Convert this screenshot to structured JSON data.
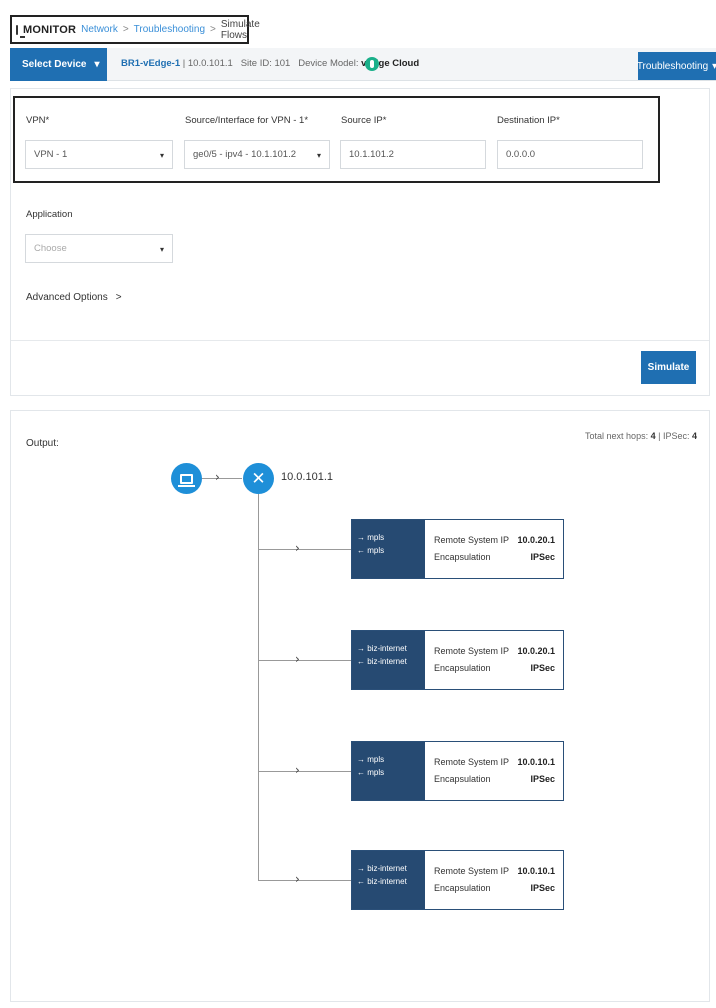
{
  "breadcrumb": {
    "monitor": "MONITOR",
    "network": "Network",
    "troubleshooting": "Troubleshooting",
    "current": "Simulate Flows",
    "separator": ">"
  },
  "device_bar": {
    "select_device": "Select Device",
    "select_caret": "▾",
    "device_name": "BR1-vEdge-1",
    "device_ip": " | 10.0.101.1",
    "site_id": "Site ID: 101",
    "model_label": "Device Model:",
    "model_value": "vEdge Cloud",
    "troubleshooting_btn": "Troubleshooting",
    "troubleshooting_caret": "▾"
  },
  "form": {
    "vpn_label": "VPN*",
    "vpn_value": "VPN - 1",
    "source_iface_label": "Source/Interface for VPN - 1*",
    "source_iface_value": "ge0/5 - ipv4 - 10.1.101.2",
    "source_ip_label": "Source IP*",
    "source_ip_value": "10.1.101.2",
    "dest_ip_label": "Destination IP*",
    "dest_ip_value": "0.0.0.0",
    "application_label": "Application",
    "application_placeholder": "Choose",
    "advanced_options": "Advanced Options",
    "advanced_chevron": ">",
    "caret": "▾",
    "simulate_btn": "Simulate"
  },
  "output": {
    "label": "Output:",
    "hops_label": "Total next hops:",
    "hops_value": "4",
    "ipsec_label": "IPSec:",
    "ipsec_value": "4",
    "router_ip": "10.0.101.1",
    "arrow": "→",
    "chevron": "›",
    "hops": [
      {
        "out_color": "→ mpls",
        "in_color": "← mpls",
        "remote_label": "Remote System IP",
        "remote_ip": "10.0.20.1",
        "encap_label": "Encapsulation",
        "encap": "IPSec"
      },
      {
        "out_color": "→ biz-internet",
        "in_color": "← biz-internet",
        "remote_label": "Remote System IP",
        "remote_ip": "10.0.20.1",
        "encap_label": "Encapsulation",
        "encap": "IPSec"
      },
      {
        "out_color": "→ mpls",
        "in_color": "← mpls",
        "remote_label": "Remote System IP",
        "remote_ip": "10.0.10.1",
        "encap_label": "Encapsulation",
        "encap": "IPSec"
      },
      {
        "out_color": "→ biz-internet",
        "in_color": "← biz-internet",
        "remote_label": "Remote System IP",
        "remote_ip": "10.0.10.1",
        "encap_label": "Encapsulation",
        "encap": "IPSec"
      }
    ]
  },
  "colors": {
    "accent": "#1f6fb2",
    "node": "#1e8fd8",
    "hop_header": "#264a72",
    "status_ok": "#1ab08a"
  },
  "icons": {
    "monitor": "monitor-icon",
    "source_node": "laptop-icon",
    "router_node": "router-icon",
    "status": "status-ok-icon"
  }
}
